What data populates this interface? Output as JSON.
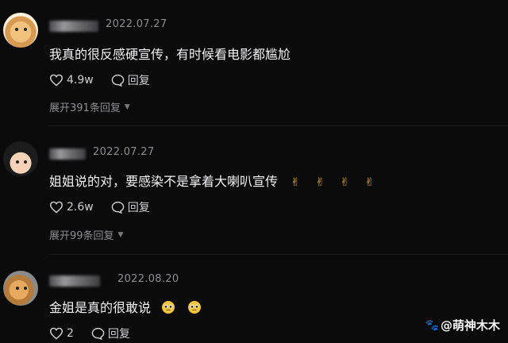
{
  "comments": [
    {
      "date": "2022.07.27",
      "text": "我真的很反感硬宣传，有时候看电影都尴尬",
      "likes": "4.9w",
      "reply_label": "回复",
      "expand": "展开391条回复"
    },
    {
      "date": "2022.07.27",
      "text": "姐姐说的对，要感染不是拿着大喇叭宣传",
      "likes": "2.6w",
      "reply_label": "回复",
      "expand": "展开99条回复"
    },
    {
      "date": "2022.08.20",
      "text": "金姐是真的很敢说",
      "likes": "2",
      "reply_label": "回复"
    }
  ],
  "watermark": {
    "text": "@萌神木木"
  },
  "colors": {
    "background": "#0b0b0c",
    "secondary_text": "#8e8e91",
    "primary_text": "#f2f2f3"
  }
}
